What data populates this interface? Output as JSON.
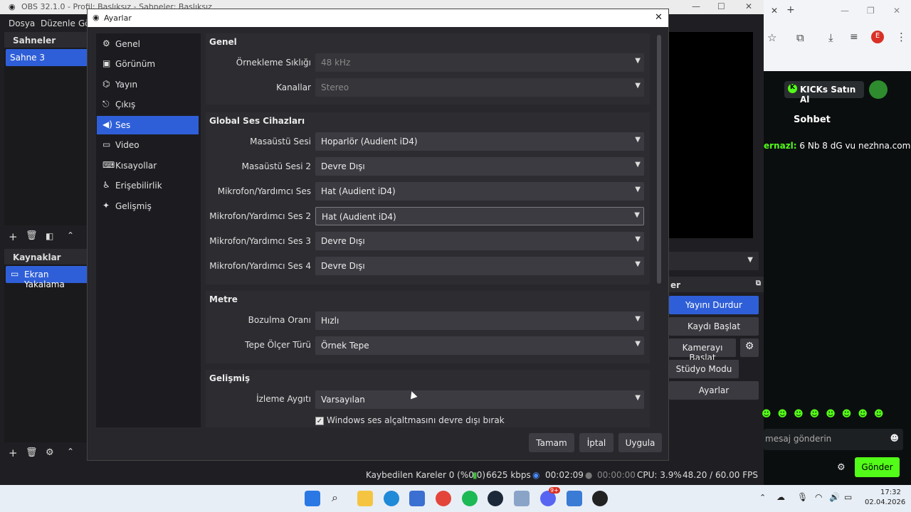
{
  "obs": {
    "title": "OBS 32.1.0 - Profil: Başlıksız - Sahneler: Başlıksız",
    "menu": [
      "Dosya",
      "Düzenle",
      "Gö"
    ],
    "scenes_title": "Sahneler",
    "scene_selected": "Sahne 3",
    "sources_title": "Kaynaklar",
    "source_selected": "Ekran Yakalama",
    "controls_title": "er",
    "controls": [
      "Yayını Durdur",
      "Kaydı Başlat",
      "Kamerayı Başlat",
      "Stüdyo Modu",
      "Ayarlar"
    ],
    "status": {
      "dropped": "Kaybedilen Kareler 0 (%0.0)",
      "bitrate": "6625 kbps",
      "stream_time": "00:02:09",
      "rec_time": "00:00:00",
      "cpu": "CPU: 3.9%",
      "fps": "48.20 / 60.00 FPS"
    }
  },
  "dialog": {
    "title": "Ayarlar",
    "nav": [
      {
        "label": "Genel",
        "icon": "gear-icon",
        "glyph": "⚙"
      },
      {
        "label": "Görünüm",
        "icon": "appearance-icon",
        "glyph": "▣"
      },
      {
        "label": "Yayın",
        "icon": "broadcast-icon",
        "glyph": "📡"
      },
      {
        "label": "Çıkış",
        "icon": "output-icon",
        "glyph": "⎋"
      },
      {
        "label": "Ses",
        "icon": "speaker-icon",
        "glyph": "🔊"
      },
      {
        "label": "Video",
        "icon": "monitor-icon",
        "glyph": "▭"
      },
      {
        "label": "Kısayollar",
        "icon": "keyboard-icon",
        "glyph": "⌨"
      },
      {
        "label": "Erişebilirlik",
        "icon": "accessibility-icon",
        "glyph": "♿"
      },
      {
        "label": "Gelişmiş",
        "icon": "tools-icon",
        "glyph": "✦"
      }
    ],
    "sections": {
      "genel": {
        "title": "Genel",
        "sample_rate_label": "Örnekleme Sıklığı",
        "sample_rate": "48 kHz",
        "channels_label": "Kanallar",
        "channels": "Stereo"
      },
      "global": {
        "title": "Global Ses Cihazları",
        "desktop1_label": "Masaüstü Sesi",
        "desktop1": "Hoparlör (Audient iD4)",
        "desktop2_label": "Masaüstü Sesi 2",
        "desktop2": "Devre Dışı",
        "mic1_label": "Mikrofon/Yardımcı Ses",
        "mic1": "Hat (Audient iD4)",
        "mic2_label": "Mikrofon/Yardımcı Ses 2",
        "mic2": "Hat (Audient iD4)",
        "mic3_label": "Mikrofon/Yardımcı Ses 3",
        "mic3": "Devre Dışı",
        "mic4_label": "Mikrofon/Yardımcı Ses 4",
        "mic4": "Devre Dışı"
      },
      "metre": {
        "title": "Metre",
        "decay_label": "Bozulma Oranı",
        "decay": "Hızlı",
        "peak_label": "Tepe Ölçer Türü",
        "peak": "Örnek Tepe"
      },
      "gelismis": {
        "title": "Gelişmiş",
        "monitor_label": "İzleme Aygıtı",
        "monitor": "Varsayılan",
        "ducking_label": "Windows ses alçaltmasını devre dışı bırak",
        "ducking_checked": true
      }
    },
    "buttons": {
      "ok": "Tamam",
      "cancel": "İptal",
      "apply": "Uygula"
    }
  },
  "browser": {
    "kicks": "KICKs Satın Al",
    "chat_title": "Sohbet",
    "chat_user": "ernazl:",
    "chat_msg": "6 Nb 8 dG vu nezhna.com",
    "input_placeholder": "mesaj gönderin",
    "send": "Gönder",
    "profile_letter": "E",
    "badge": "9+"
  },
  "taskbar": {
    "time": "17:32",
    "date": "02.04.2026"
  },
  "colors": {
    "accent": "#2f5fd8",
    "kick_green": "#53fc18"
  }
}
